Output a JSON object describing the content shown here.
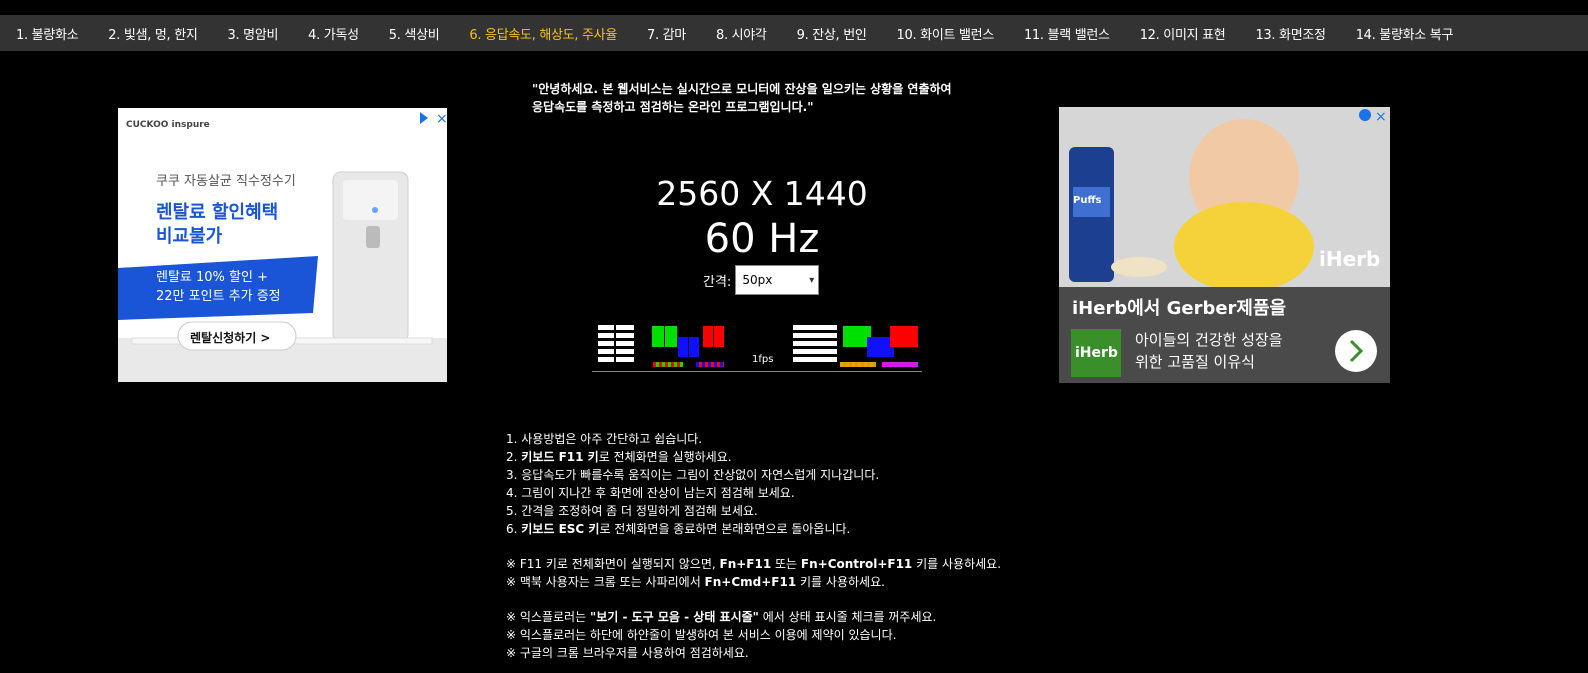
{
  "nav": {
    "items": [
      {
        "label": "1. 불량화소"
      },
      {
        "label": "2. 빛샘, 멍, 한지"
      },
      {
        "label": "3. 명암비"
      },
      {
        "label": "4. 가독성"
      },
      {
        "label": "5. 색상비"
      },
      {
        "label": "6. 응답속도, 해상도, 주사율"
      },
      {
        "label": "7. 감마"
      },
      {
        "label": "8. 시야각"
      },
      {
        "label": "9. 잔상, 번인"
      },
      {
        "label": "10. 화이트 밸런스"
      },
      {
        "label": "11. 블랙 밸런스"
      },
      {
        "label": "12. 이미지 표현"
      },
      {
        "label": "13. 화면조정"
      },
      {
        "label": "14. 불량화소 복구"
      }
    ],
    "active_index": 5,
    "active_color": "#f5c518"
  },
  "intro": {
    "line1": "\"안녕하세요. 본 웹서비스는 실시간으로 모니터에 잔상을 일으키는 상황을 연출하여",
    "line2": "응답속도를 측정하고 점검하는 온라인 프로그램입니다.\""
  },
  "display": {
    "resolution": "2560 X 1440",
    "refresh": "60 Hz"
  },
  "gap": {
    "label": "간격:",
    "selected": "50px"
  },
  "test": {
    "fps_label": "1fps",
    "colors": {
      "green": "#00e000",
      "blue": "#1010ff",
      "red": "#ff0000",
      "white": "#ffffff"
    }
  },
  "ad_left": {
    "brand": "CUCKOO inspure",
    "line1": "쿠쿠 자동살균 직수정수기",
    "line2": "렌탈료 할인혜택",
    "line3": "비교불가",
    "promo1": "렌탈료 10% 할인 +",
    "promo2": "22만 포인트 추가 증정",
    "cta": "렌탈신청하기 >"
  },
  "ad_right": {
    "brand": "iHerb",
    "headline": "iHerb에서 Gerber제품을",
    "sub1": "아이들의 건강한 성장을",
    "sub2": "위한 고품질 이유식",
    "logo_text": "iHerb",
    "product": "Puffs"
  },
  "instructions": {
    "i1": "1. 사용방법은 아주 간단하고 쉽습니다.",
    "i2_pre": "2. ",
    "i2_bold": "키보드 F11 키",
    "i2_post": "로 전체화면을 실행하세요.",
    "i3": "3. 응답속도가 빠를수록 움직이는 그림이 잔상없이 자연스럽게 지나갑니다.",
    "i4": "4. 그림이 지나간 후 화면에 잔상이 남는지 점검해 보세요.",
    "i5": "5. 간격을 조정하여 좀 더 정밀하게 점검해 보세요.",
    "i6_pre": "6. ",
    "i6_bold": "키보드 ESC 키",
    "i6_post": "로 전체화면을 종료하면 본래화면으로 돌아옵니다.",
    "n1_pre": "※ F11 키로 전체화면이 실행되지 않으면, ",
    "n1_b1": "Fn+F11",
    "n1_mid1": " 또는 ",
    "n1_b2": "Fn+Control+F11",
    "n1_post": " 키를 사용하세요.",
    "n2_pre": "※ 맥북 사용자는 크롬 또는 사파리에서 ",
    "n2_b": "Fn+Cmd+F11",
    "n2_post": " 키를 사용하세요.",
    "n3_pre": "※ 익스플로러는 ",
    "n3_b": "\"보기 - 도구 모음 - 상태 표시줄\"",
    "n3_post": " 에서 상태 표시줄 체크를 꺼주세요.",
    "n4": "※ 익스플로러는 하단에 하얀줄이 발생하여 본 서비스 이용에 제약이 있습니다.",
    "n5": "※ 구글의 크롬 브라우저를 사용하여 점검하세요."
  }
}
